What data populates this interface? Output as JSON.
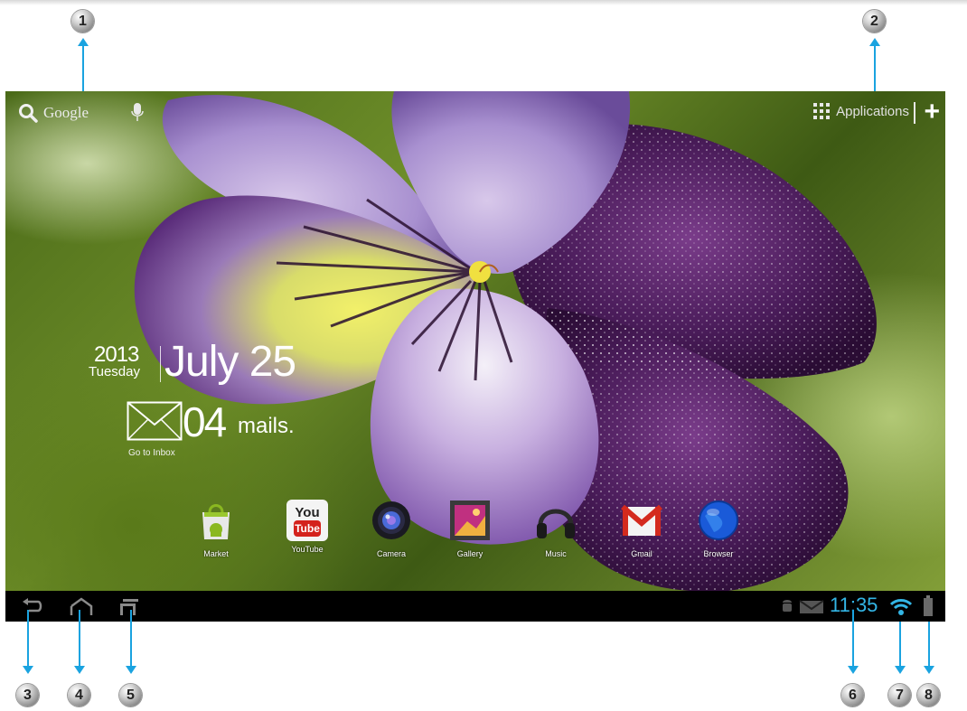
{
  "search": {
    "label": "Google",
    "icon": "search-icon",
    "voice_icon": "mic-icon"
  },
  "apps_button": {
    "label": "Applications",
    "icon": "apps-grid-icon"
  },
  "add_button": {
    "icon": "plus-icon"
  },
  "date_widget": {
    "year": "2013",
    "weekday": "Tuesday",
    "date": "July 25"
  },
  "mail_widget": {
    "count": "04",
    "unit": "mails.",
    "link": "Go to Inbox",
    "icon": "envelope-icon"
  },
  "dock": [
    {
      "label": "Market",
      "icon": "market-icon"
    },
    {
      "label": "YouTube",
      "icon": "youtube-icon",
      "logo_text_1": "You",
      "logo_text_2": "Tube"
    },
    {
      "label": "Camera",
      "icon": "camera-icon"
    },
    {
      "label": "Gallery",
      "icon": "gallery-icon"
    },
    {
      "label": "Music",
      "icon": "music-icon"
    },
    {
      "label": "Gmail",
      "icon": "gmail-icon"
    },
    {
      "label": "Browser",
      "icon": "browser-icon"
    }
  ],
  "system_bar": {
    "nav": [
      "back-icon",
      "home-icon",
      "recent-apps-icon"
    ],
    "notifications": [
      "android-debug-icon",
      "mail-notification-icon"
    ],
    "time": "11:35",
    "wifi_icon": "wifi-icon",
    "battery_icon": "battery-icon"
  },
  "callouts": [
    "1",
    "2",
    "3",
    "4",
    "5",
    "6",
    "7",
    "8"
  ],
  "colors": {
    "accent": "#33b5e5",
    "callout_arrow": "#1aa3e0",
    "system_bar": "#000000"
  }
}
